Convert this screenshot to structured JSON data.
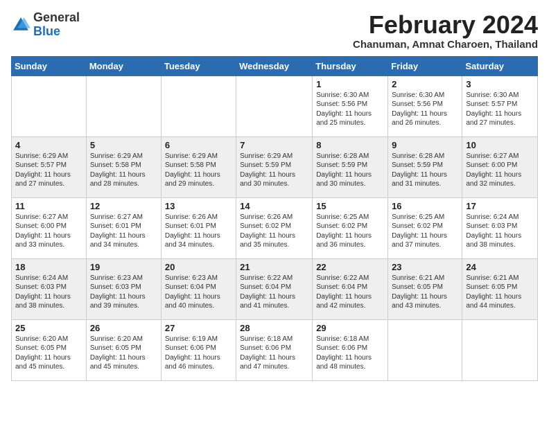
{
  "header": {
    "logo_line1": "General",
    "logo_line2": "Blue",
    "month_year": "February 2024",
    "location": "Chanuman, Amnat Charoen, Thailand"
  },
  "weekdays": [
    "Sunday",
    "Monday",
    "Tuesday",
    "Wednesday",
    "Thursday",
    "Friday",
    "Saturday"
  ],
  "weeks": [
    [
      {
        "day": "",
        "info": ""
      },
      {
        "day": "",
        "info": ""
      },
      {
        "day": "",
        "info": ""
      },
      {
        "day": "",
        "info": ""
      },
      {
        "day": "1",
        "info": "Sunrise: 6:30 AM\nSunset: 5:56 PM\nDaylight: 11 hours and 25 minutes."
      },
      {
        "day": "2",
        "info": "Sunrise: 6:30 AM\nSunset: 5:56 PM\nDaylight: 11 hours and 26 minutes."
      },
      {
        "day": "3",
        "info": "Sunrise: 6:30 AM\nSunset: 5:57 PM\nDaylight: 11 hours and 27 minutes."
      }
    ],
    [
      {
        "day": "4",
        "info": "Sunrise: 6:29 AM\nSunset: 5:57 PM\nDaylight: 11 hours and 27 minutes."
      },
      {
        "day": "5",
        "info": "Sunrise: 6:29 AM\nSunset: 5:58 PM\nDaylight: 11 hours and 28 minutes."
      },
      {
        "day": "6",
        "info": "Sunrise: 6:29 AM\nSunset: 5:58 PM\nDaylight: 11 hours and 29 minutes."
      },
      {
        "day": "7",
        "info": "Sunrise: 6:29 AM\nSunset: 5:59 PM\nDaylight: 11 hours and 30 minutes."
      },
      {
        "day": "8",
        "info": "Sunrise: 6:28 AM\nSunset: 5:59 PM\nDaylight: 11 hours and 30 minutes."
      },
      {
        "day": "9",
        "info": "Sunrise: 6:28 AM\nSunset: 5:59 PM\nDaylight: 11 hours and 31 minutes."
      },
      {
        "day": "10",
        "info": "Sunrise: 6:27 AM\nSunset: 6:00 PM\nDaylight: 11 hours and 32 minutes."
      }
    ],
    [
      {
        "day": "11",
        "info": "Sunrise: 6:27 AM\nSunset: 6:00 PM\nDaylight: 11 hours and 33 minutes."
      },
      {
        "day": "12",
        "info": "Sunrise: 6:27 AM\nSunset: 6:01 PM\nDaylight: 11 hours and 34 minutes."
      },
      {
        "day": "13",
        "info": "Sunrise: 6:26 AM\nSunset: 6:01 PM\nDaylight: 11 hours and 34 minutes."
      },
      {
        "day": "14",
        "info": "Sunrise: 6:26 AM\nSunset: 6:02 PM\nDaylight: 11 hours and 35 minutes."
      },
      {
        "day": "15",
        "info": "Sunrise: 6:25 AM\nSunset: 6:02 PM\nDaylight: 11 hours and 36 minutes."
      },
      {
        "day": "16",
        "info": "Sunrise: 6:25 AM\nSunset: 6:02 PM\nDaylight: 11 hours and 37 minutes."
      },
      {
        "day": "17",
        "info": "Sunrise: 6:24 AM\nSunset: 6:03 PM\nDaylight: 11 hours and 38 minutes."
      }
    ],
    [
      {
        "day": "18",
        "info": "Sunrise: 6:24 AM\nSunset: 6:03 PM\nDaylight: 11 hours and 38 minutes."
      },
      {
        "day": "19",
        "info": "Sunrise: 6:23 AM\nSunset: 6:03 PM\nDaylight: 11 hours and 39 minutes."
      },
      {
        "day": "20",
        "info": "Sunrise: 6:23 AM\nSunset: 6:04 PM\nDaylight: 11 hours and 40 minutes."
      },
      {
        "day": "21",
        "info": "Sunrise: 6:22 AM\nSunset: 6:04 PM\nDaylight: 11 hours and 41 minutes."
      },
      {
        "day": "22",
        "info": "Sunrise: 6:22 AM\nSunset: 6:04 PM\nDaylight: 11 hours and 42 minutes."
      },
      {
        "day": "23",
        "info": "Sunrise: 6:21 AM\nSunset: 6:05 PM\nDaylight: 11 hours and 43 minutes."
      },
      {
        "day": "24",
        "info": "Sunrise: 6:21 AM\nSunset: 6:05 PM\nDaylight: 11 hours and 44 minutes."
      }
    ],
    [
      {
        "day": "25",
        "info": "Sunrise: 6:20 AM\nSunset: 6:05 PM\nDaylight: 11 hours and 45 minutes."
      },
      {
        "day": "26",
        "info": "Sunrise: 6:20 AM\nSunset: 6:05 PM\nDaylight: 11 hours and 45 minutes."
      },
      {
        "day": "27",
        "info": "Sunrise: 6:19 AM\nSunset: 6:06 PM\nDaylight: 11 hours and 46 minutes."
      },
      {
        "day": "28",
        "info": "Sunrise: 6:18 AM\nSunset: 6:06 PM\nDaylight: 11 hours and 47 minutes."
      },
      {
        "day": "29",
        "info": "Sunrise: 6:18 AM\nSunset: 6:06 PM\nDaylight: 11 hours and 48 minutes."
      },
      {
        "day": "",
        "info": ""
      },
      {
        "day": "",
        "info": ""
      }
    ]
  ]
}
